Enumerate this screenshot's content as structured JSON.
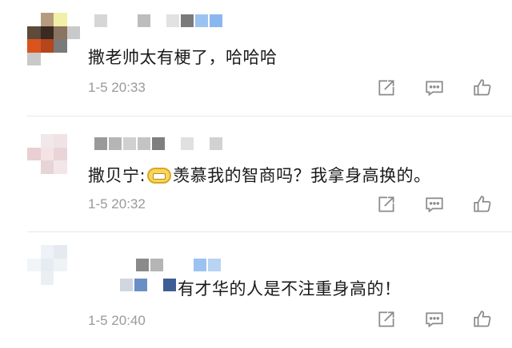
{
  "comments": [
    {
      "text": "撒老帅太有梗了，哈哈哈",
      "time": "1-5 20:33"
    },
    {
      "text_prefix": "撒贝宁:",
      "emoji_icon": "grin-emoji-icon",
      "text_suffix": "羡慕我的智商吗？我拿身高换的。",
      "time": "1-5 20:32"
    },
    {
      "text": "有才华的人是不注重身高的！",
      "time": "1-5 20:40"
    }
  ],
  "actions": {
    "icons": [
      "share-icon",
      "reply-icon",
      "like-icon"
    ]
  },
  "colors": {
    "text": "#1a1a1a",
    "time": "#9a9a9a",
    "icon": "#8a8a8a",
    "divider": "#e8e8e8"
  }
}
